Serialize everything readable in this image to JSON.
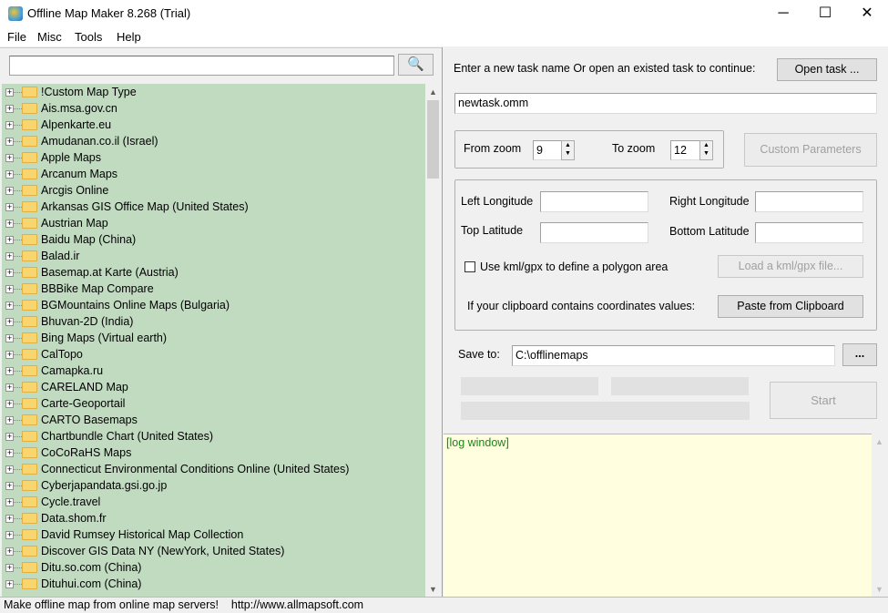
{
  "window": {
    "title": "Offline Map Maker 8.268 (Trial)",
    "minimize": "─",
    "maximize": "☐",
    "close": "✕"
  },
  "menu": [
    "File",
    "Misc",
    "Tools",
    "Help"
  ],
  "search": {
    "value": "",
    "button_icon": "magnifier-icon"
  },
  "tree": [
    "!Custom Map Type",
    "Ais.msa.gov.cn",
    "Alpenkarte.eu",
    "Amudanan.co.il (Israel)",
    "Apple Maps",
    "Arcanum Maps",
    "Arcgis Online",
    "Arkansas GIS Office Map (United States)",
    "Austrian Map",
    "Baidu Map (China)",
    "Balad.ir",
    "Basemap.at Karte (Austria)",
    "BBBike Map Compare",
    "BGMountains Online Maps (Bulgaria)",
    "Bhuvan-2D (India)",
    "Bing Maps (Virtual earth)",
    "CalTopo",
    "Camapka.ru",
    "CARELAND Map",
    "Carte-Geoportail",
    "CARTO Basemaps",
    "Chartbundle Chart (United States)",
    "CoCoRaHS Maps",
    "Connecticut Environmental Conditions Online (United States)",
    "Cyberjapandata.gsi.go.jp",
    "Cycle.travel",
    "Data.shom.fr",
    "David Rumsey Historical Map Collection",
    "Discover GIS Data NY (NewYork, United States)",
    "Ditu.so.com (China)",
    "Dituhui.com (China)"
  ],
  "task": {
    "prompt": "Enter a new task name Or open an existed task to continue:",
    "open_button": "Open task ...",
    "name": "newtask.omm"
  },
  "zoom": {
    "from_label": "From zoom",
    "from_value": "9",
    "to_label": "To zoom",
    "to_value": "12",
    "custom_button": "Custom Parameters"
  },
  "coords": {
    "left_lon": "Left Longitude",
    "right_lon": "Right Longitude",
    "top_lat": "Top Latitude",
    "bottom_lat": "Bottom Latitude",
    "left_lon_value": "",
    "right_lon_value": "",
    "top_lat_value": "",
    "bottom_lat_value": "",
    "polygon_checkbox": "Use kml/gpx to define a polygon area",
    "polygon_checked": false,
    "load_button": "Load a kml/gpx file...",
    "clipboard_label": "If your clipboard contains coordinates values:",
    "paste_button": "Paste from Clipboard"
  },
  "save": {
    "label": "Save to:",
    "value": "C:\\offlinemaps",
    "browse": "...",
    "start": "Start"
  },
  "log": {
    "text": "[log window]"
  },
  "status": {
    "text": "Make offline map from online map servers!    http://www.allmapsoft.com"
  }
}
